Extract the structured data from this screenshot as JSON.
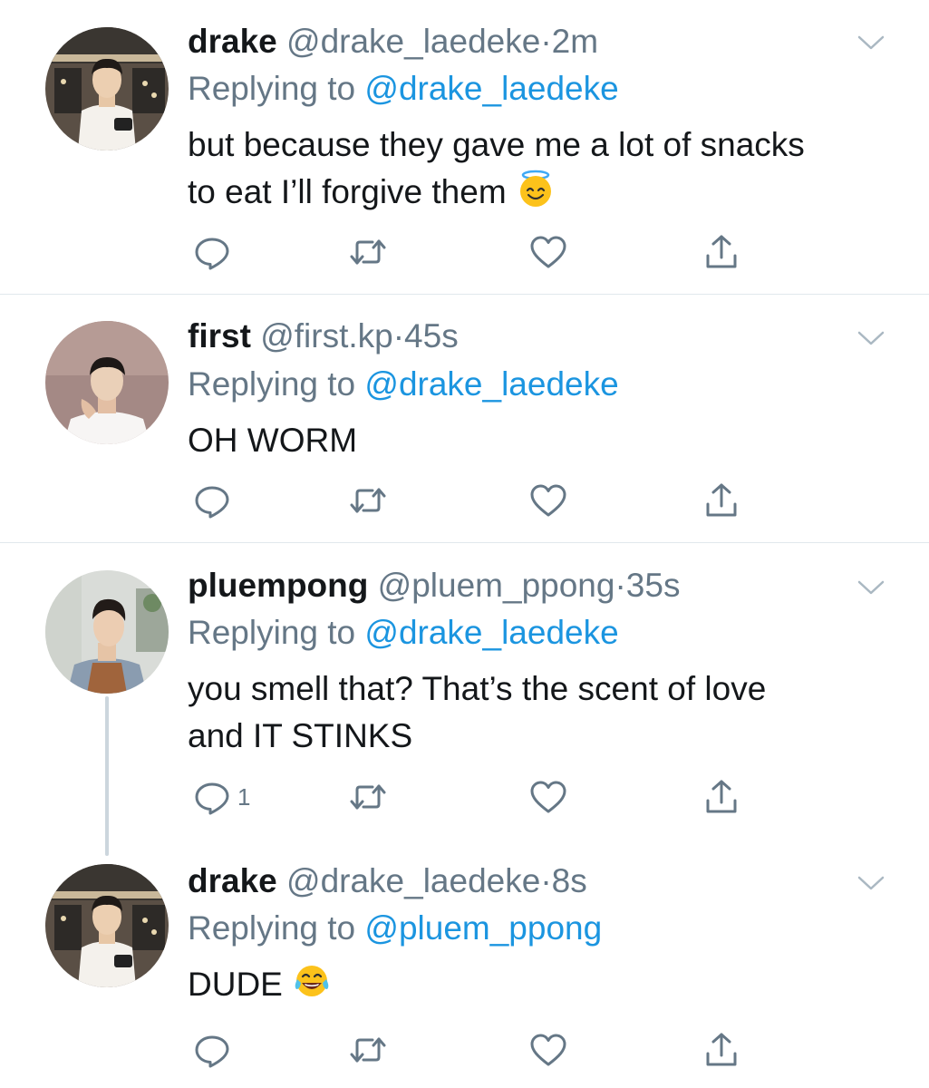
{
  "tweets": [
    {
      "name": "drake",
      "handle": "@drake_laedeke",
      "dot": "·",
      "time": "2m",
      "replying_prefix": "Replying to ",
      "replying_to": "@drake_laedeke",
      "body_line1": "but because they gave me a lot of snacks",
      "body_line2": "to eat I’ll forgive them",
      "emoji_icon": "smiling-face-with-halo-icon",
      "reply_count": ""
    },
    {
      "name": "first",
      "handle": "@first.kp",
      "dot": "·",
      "time": "45s",
      "replying_prefix": "Replying to ",
      "replying_to": "@drake_laedeke",
      "body_line1": "OH WORM",
      "body_line2": "",
      "reply_count": ""
    },
    {
      "name": "pluempong",
      "handle": "@pluem_ppong",
      "dot": "·",
      "time": "35s",
      "replying_prefix": "Replying to ",
      "replying_to": "@drake_laedeke",
      "body_line1": "you smell that? That’s the scent of love",
      "body_line2": "and IT STINKS",
      "reply_count": "1"
    },
    {
      "name": "drake",
      "handle": "@drake_laedeke",
      "dot": "·",
      "time": "8s",
      "replying_prefix": "Replying to ",
      "replying_to": "@pluem_ppong",
      "body_line1": "DUDE",
      "body_line2": "",
      "emoji_icon": "face-with-tears-of-joy-icon",
      "reply_count": ""
    }
  ],
  "colors": {
    "text": "#14171a",
    "secondary": "#657786",
    "link": "#1b95e0",
    "divider": "#e1e8ed",
    "thread_line": "#ccd6dd"
  },
  "icons": [
    "reply-icon",
    "retweet-icon",
    "like-icon",
    "share-icon",
    "chevron-down-icon"
  ]
}
